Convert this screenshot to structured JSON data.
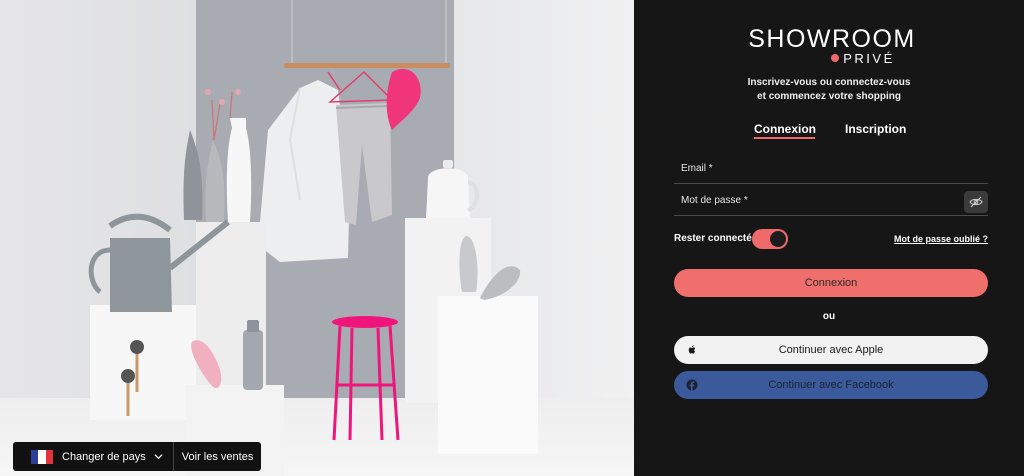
{
  "brand": {
    "name": "SHOWROOM",
    "sub": "PRIVÉ",
    "accent": "#ef6b6b"
  },
  "intro": {
    "line1": "Inscrivez-vous ou connectez-vous",
    "line2": "et commencez votre shopping"
  },
  "tabs": [
    {
      "label": "Connexion",
      "active": true
    },
    {
      "label": "Inscription",
      "active": false
    }
  ],
  "form": {
    "email_label": "Email *",
    "password_label": "Mot de passe *",
    "remember_label": "Rester connecté.e",
    "remember_on": true,
    "forgot_label": "Mot de passe oublié ?",
    "password_toggle_icon": "eye-slash-icon"
  },
  "actions": {
    "login_label": "Connexion",
    "or_label": "ou",
    "apple_label": "Continuer avec Apple",
    "facebook_label": "Continuer avec Facebook"
  },
  "country_bar": {
    "change_country_label": "Changer de pays",
    "view_sales_label": "Voir les ventes",
    "flag": "france-flag-icon"
  }
}
